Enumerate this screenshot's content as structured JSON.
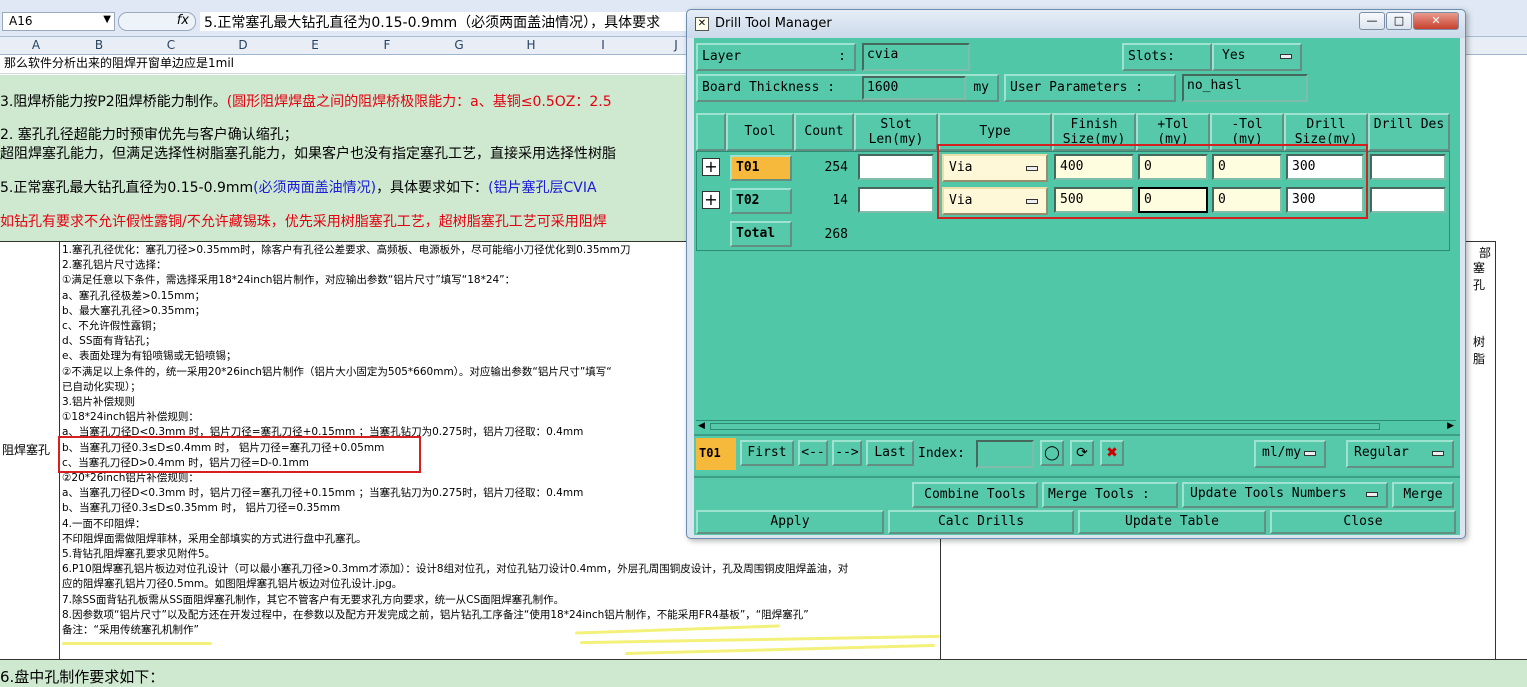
{
  "excel": {
    "name_box": "A16",
    "fx": "fx",
    "formula": "5.正常塞孔最大钻孔直径为0.15-0.9mm（必须两面盖油情况），具体要求",
    "columns": [
      "A",
      "B",
      "C",
      "D",
      "E",
      "F",
      "G",
      "H",
      "I",
      "J"
    ],
    "row1": "那么软件分析出来的阻焊开窗单边应是1mil",
    "row_a_black": "3.阻焊桥能力按P2阻焊桥能力制作。",
    "row_a_red": "(圆形阻焊焊盘之间的阻焊桥极限能力：a、基铜≤0.5OZ：2.5",
    "row_b": "2. 塞孔孔径超能力时预审优先与客户确认缩孔；",
    "row_c": "超阻焊塞孔能力，但满足选择性树脂塞孔能力，如果客户也没有指定塞孔工艺，直接采用选择性树脂",
    "row_d_black": "5.正常塞孔最大钻孔直径为0.15-0.9mm",
    "row_d_blue1": "(必须两面盖油情况)",
    "row_d_black2": "，具体要求如下：",
    "row_d_blue2": "(铝片塞孔层CVIA",
    "row_e": "如钻孔有要求不允许假性露铜/不允许藏锡珠，优先采用树脂塞孔工艺，超树脂塞孔工艺可采用阻焊",
    "label_cell": "阻焊塞孔",
    "notes": [
      "1.塞孔孔径优化：塞孔刀径>0.35mm时，除客户有孔径公差要求、高频板、电源板外，尽可能缩小刀径优化到0.35mm刀",
      "2.塞孔铝片尺寸选择：",
      "①满足任意以下条件，需选择采用18*24inch铝片制作，对应输出参数“铝片尺寸”填写“18*24”：",
      "a、塞孔孔径极差>0.15mm；",
      "b、最大塞孔孔径>0.35mm；",
      "c、不允许假性露铜；",
      "d、SS面有背钻孔；",
      "e、表面处理为有铅喷锡或无铅喷锡；",
      "②不满足以上条件的，统一采用20*26inch铝片制作（铝片大小固定为505*660mm）。对应输出参数“铝片尺寸”填写“",
      "已自动化实现）；",
      "3.铝片补偿规则",
      "①18*24inch铝片补偿规则：",
      "a、当塞孔刀径D<0.3mm 时，铝片刀径=塞孔刀径+0.15mm ；当塞孔钻刀为0.275时，铝片刀径取：0.4mm",
      "b、当塞孔刀径0.3≤D≤0.4mm 时， 铝片刀径=塞孔刀径+0.05mm",
      "c、当塞孔刀径D>0.4mm 时，铝片刀径=D-0.1mm",
      "②20*26inch铝片补偿规则：",
      "a、当塞孔刀径D<0.3mm 时，铝片刀径=塞孔刀径+0.15mm ；当塞孔钻刀为0.275时，铝片刀径取：0.4mm",
      "b、当塞孔刀径0.3≤D≤0.35mm 时， 铝片刀径=0.35mm",
      "4.一面不印阻焊：",
      "不印阻焊面需做阻焊菲林，采用全部填实的方式进行盘中孔塞孔。",
      "5.背钻孔阻焊塞孔要求见附件5。",
      "6.P10阻焊塞孔铝片板边对位孔设计（可以最小塞孔刀径>0.3mm才添加）：设计8组对位孔，对位孔钻刀设计0.4mm，外层孔周围铜皮设计，孔及周围铜皮阻焊盖油，对",
      "应的阻焊塞孔铝片刀径0.5mm。如图阻焊塞孔铝片板边对位孔设计.jpg。",
      "7.除SS面背钻孔板需从SS面阻焊塞孔制作，其它不管客户有无要求孔方向要求，统一从CS面阻焊塞孔制作。",
      "8.因参数项“铝片尺寸”以及配方还在开发过程中，在参数以及配方开发完成之前，铝片钻孔工序备注“使用18*24inch铝片制作，不能采用FR4基板”，“阻焊塞孔”",
      "备注：“采用传统塞孔机制作”"
    ],
    "right_frag1": "部",
    "right_frag2": "塞孔",
    "right_frag3": "树脂",
    "last_row": "6.盘中孔制作要求如下："
  },
  "dialog": {
    "title": "Drill Tool Manager",
    "win_min": "—",
    "win_max": "□",
    "win_close": "✕",
    "layer_label": "Layer",
    "colon": ":",
    "layer_value": "cvia",
    "slots_label": "Slots:",
    "slots_value": "Yes",
    "thickness_label": "Board Thickness :",
    "thickness_value": "1600",
    "thickness_unit": "my",
    "user_params_label": "User Parameters :",
    "user_params_value": "no_hasl",
    "headers": {
      "tool": "Tool",
      "count": "Count",
      "slot": "Slot Len(my)",
      "type": "Type",
      "finish": "Finish Size(my)",
      "ptol": "+Tol (my)",
      "mtol": "-Tol (my)",
      "drill": "Drill Size(my)",
      "des": "Drill Des"
    },
    "rows": [
      {
        "tool": "T01",
        "count": "254",
        "type": "Via",
        "finish": "400",
        "ptol": "0",
        "mtol": "0",
        "drill": "300"
      },
      {
        "tool": "T02",
        "count": "14",
        "type": "Via",
        "finish": "500",
        "ptol": "0",
        "mtol": "0",
        "drill": "300"
      }
    ],
    "total_label": "Total",
    "total_count": "268",
    "nav_current": "T01",
    "nav_first": "First",
    "nav_prev": "<--",
    "nav_next": "-->",
    "nav_last": "Last",
    "index_label": "Index:",
    "unit_value": "ml/my",
    "mode_value": "Regular",
    "combine": "Combine Tools",
    "merge_label": "Merge Tools :",
    "update_numbers": "Update Tools Numbers",
    "merge": "Merge",
    "apply": "Apply",
    "calc": "Calc Drills",
    "update_table": "Update Table",
    "close": "Close",
    "colors": {
      "body": "#50c8a8",
      "field": "#fffde0",
      "highlight": "#f6b93c",
      "annotation": "#d42020"
    }
  }
}
